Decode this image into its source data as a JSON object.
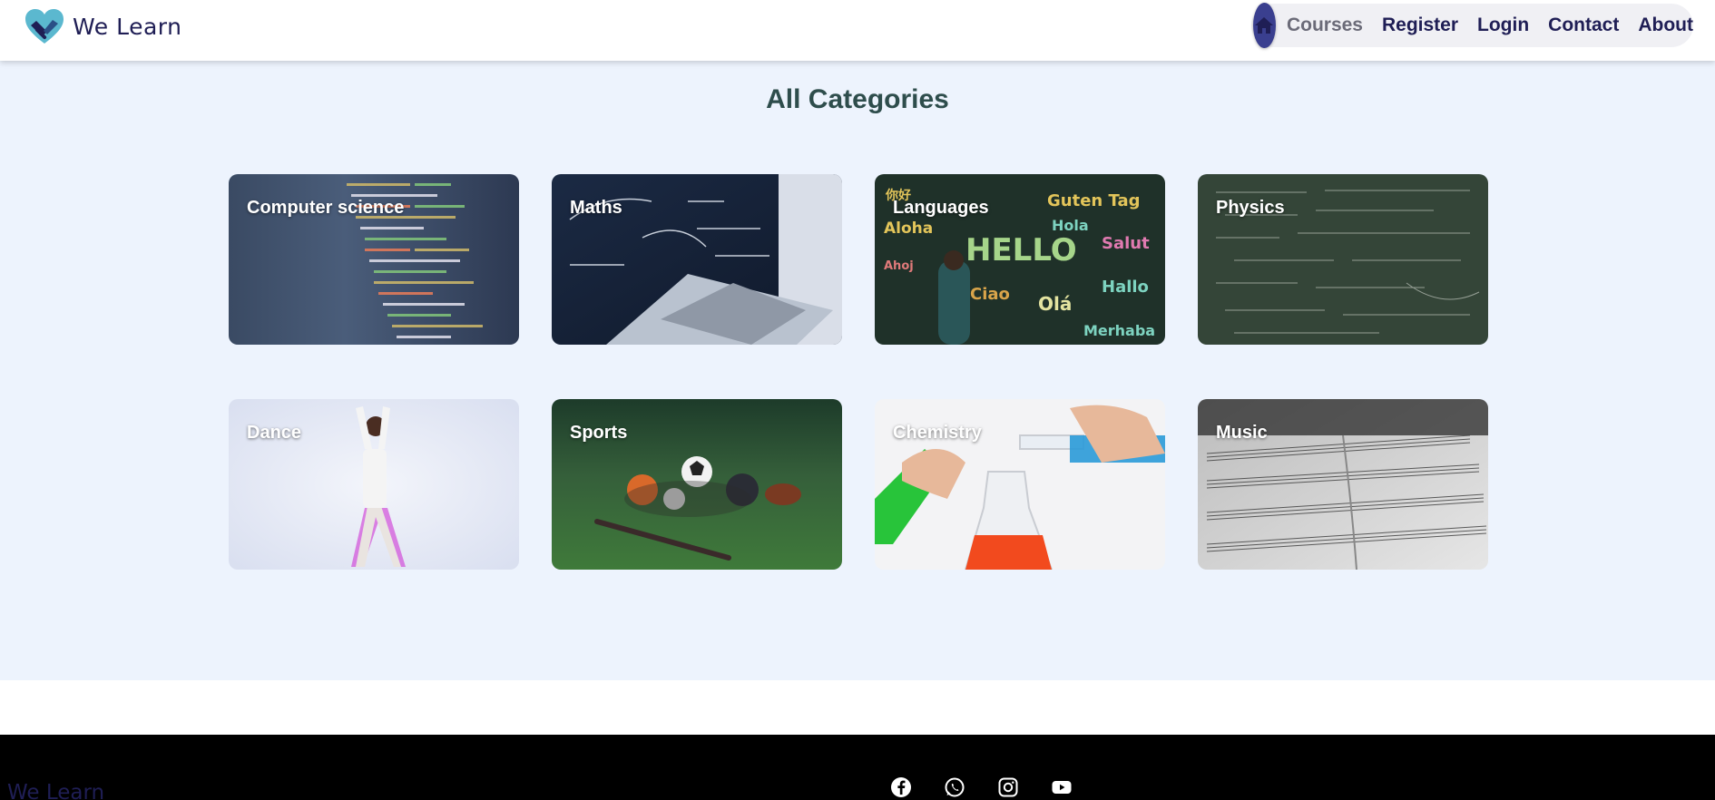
{
  "brand": {
    "name": "We Learn",
    "logo_icon": "handshake-heart-icon"
  },
  "nav": {
    "home_icon": "home-icon",
    "items": [
      {
        "label": "Courses",
        "active": true
      },
      {
        "label": "Register"
      },
      {
        "label": "Login"
      },
      {
        "label": "Contact"
      },
      {
        "label": "About"
      }
    ]
  },
  "main": {
    "title": "All Categories",
    "categories": [
      {
        "label": "Computer science"
      },
      {
        "label": "Maths"
      },
      {
        "label": "Languages"
      },
      {
        "label": "Physics"
      },
      {
        "label": "Dance"
      },
      {
        "label": "Sports"
      },
      {
        "label": "Chemistry"
      },
      {
        "label": "Music"
      }
    ]
  },
  "footer": {
    "brand": "We Learn",
    "socials": [
      "facebook-icon",
      "whatsapp-icon",
      "instagram-icon",
      "youtube-icon"
    ]
  },
  "colors": {
    "brand": "#1f1e55",
    "home_button": "#3a3f8f",
    "page_bg": "#edf3fd",
    "title": "#2e4d4c",
    "footer_bg": "#000000"
  }
}
